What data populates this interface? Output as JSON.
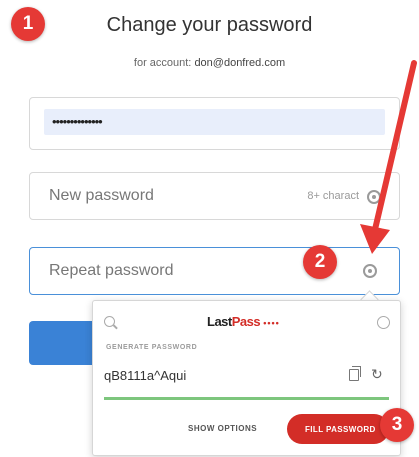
{
  "header": {
    "title": "Change your password",
    "subtitle_prefix": "for account: ",
    "account": "don@donfred.com"
  },
  "fields": {
    "current_password_value": "••••••••••••••",
    "new_password_placeholder": "New password",
    "new_password_hint": "8+ charact",
    "repeat_password_placeholder": "Repeat password"
  },
  "lastpass": {
    "logo_main": "Last",
    "logo_accent": "Pass",
    "logo_dots": "••••",
    "section_label": "GENERATE PASSWORD",
    "generated_password": "qB8111a^Aqui",
    "strength_fraction": 1.0,
    "show_options": "SHOW OPTIONS",
    "fill_password": "FILL PASSWORD"
  },
  "annotations": {
    "step1": "1",
    "step2": "2",
    "step3": "3",
    "color": "#e53935"
  }
}
